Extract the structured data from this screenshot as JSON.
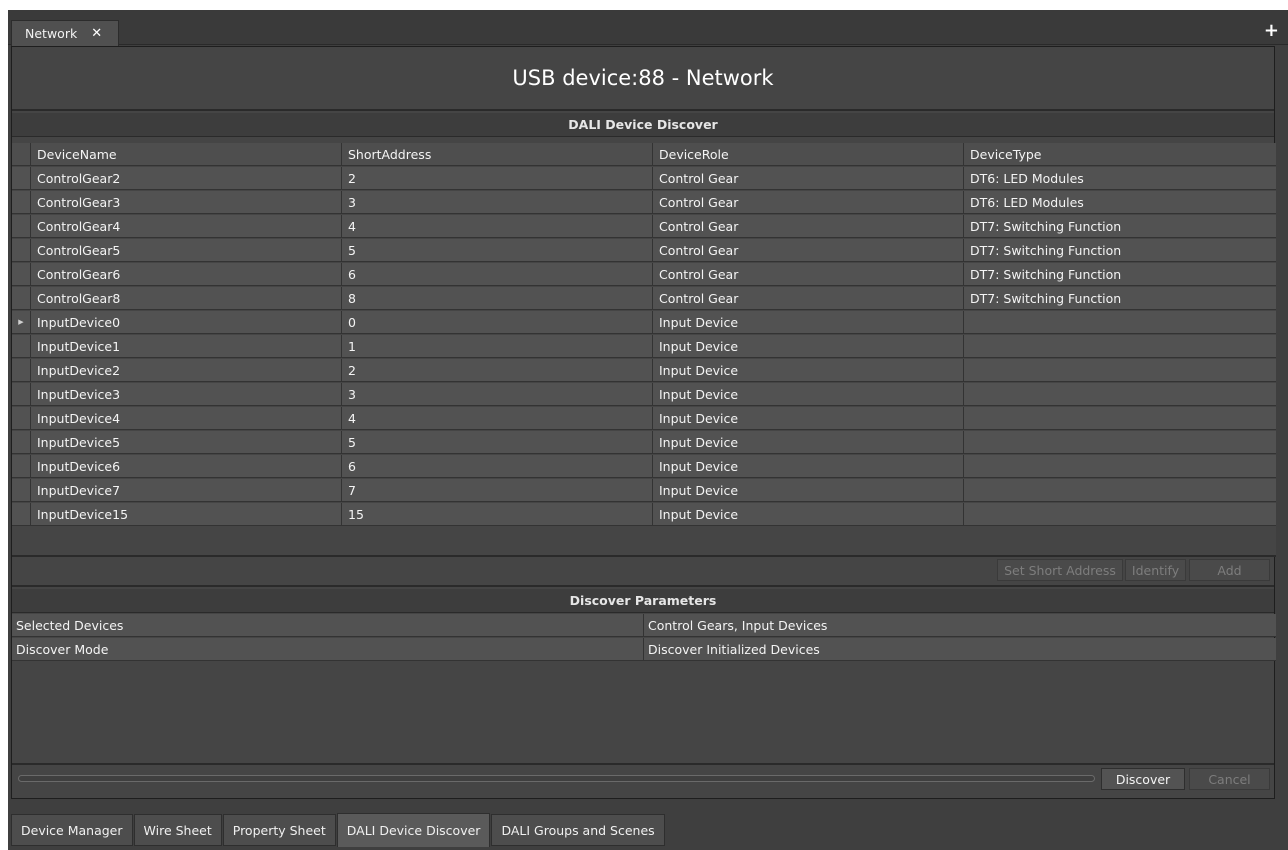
{
  "doc_tab": {
    "label": "Network",
    "close_glyph": "✕"
  },
  "add_tab_glyph": "+",
  "window_title": "USB device:88 - Network",
  "discover": {
    "header": "DALI Device Discover",
    "columns": [
      "DeviceName",
      "ShortAddress",
      "DeviceRole",
      "DeviceType"
    ],
    "rows": [
      [
        "ControlGear2",
        "2",
        "Control Gear",
        "DT6: LED Modules"
      ],
      [
        "ControlGear3",
        "3",
        "Control Gear",
        "DT6: LED Modules"
      ],
      [
        "ControlGear4",
        "4",
        "Control Gear",
        "DT7: Switching Function"
      ],
      [
        "ControlGear5",
        "5",
        "Control Gear",
        "DT7: Switching Function"
      ],
      [
        "ControlGear6",
        "6",
        "Control Gear",
        "DT7: Switching Function"
      ],
      [
        "ControlGear8",
        "8",
        "Control Gear",
        "DT7: Switching Function"
      ],
      [
        "InputDevice0",
        "0",
        "Input Device",
        ""
      ],
      [
        "InputDevice1",
        "1",
        "Input Device",
        ""
      ],
      [
        "InputDevice2",
        "2",
        "Input Device",
        ""
      ],
      [
        "InputDevice3",
        "3",
        "Input Device",
        ""
      ],
      [
        "InputDevice4",
        "4",
        "Input Device",
        ""
      ],
      [
        "InputDevice5",
        "5",
        "Input Device",
        ""
      ],
      [
        "InputDevice6",
        "6",
        "Input Device",
        ""
      ],
      [
        "InputDevice7",
        "7",
        "Input Device",
        ""
      ],
      [
        "InputDevice15",
        "15",
        "Input Device",
        ""
      ]
    ],
    "current_row": 6,
    "current_row_indicator": "▶"
  },
  "actions": {
    "set_short_address": "Set Short Address",
    "identify": "Identify",
    "add": "Add"
  },
  "parameters": {
    "header": "Discover Parameters",
    "rows": [
      [
        "Selected Devices",
        "Control Gears,  Input Devices"
      ],
      [
        "Discover Mode",
        "Discover Initialized Devices"
      ]
    ]
  },
  "buttons": {
    "discover": "Discover",
    "cancel": "Cancel"
  },
  "bottom_tabs": [
    "Device Manager",
    "Wire Sheet",
    "Property Sheet",
    "DALI Device Discover",
    "DALI Groups and Scenes"
  ],
  "active_bottom_tab": 3,
  "colors": {
    "panel_bg": "#454545",
    "row_bg": "#525252",
    "grid_line": "#333333",
    "text": "#f4f4f4",
    "disabled_text": "#7d7d7d"
  }
}
